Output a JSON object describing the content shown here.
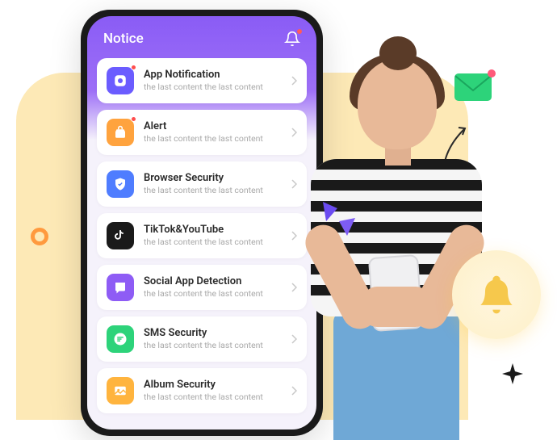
{
  "header": {
    "title": "Notice"
  },
  "items": [
    {
      "title": "App Notification",
      "sub": "the last content the last content",
      "icon": "app-notification-icon",
      "bg": "ic-notif",
      "dot": true
    },
    {
      "title": "Alert",
      "sub": "the last content the last content",
      "icon": "alert-icon",
      "bg": "ic-alert",
      "dot": true
    },
    {
      "title": "Browser Security",
      "sub": "the last content the last content",
      "icon": "browser-security-icon",
      "bg": "ic-browser",
      "dot": false
    },
    {
      "title": "TikTok&YouTube",
      "sub": "the last content the last content",
      "icon": "tiktok-youtube-icon",
      "bg": "ic-tiktok",
      "dot": false
    },
    {
      "title": "Social App Detection",
      "sub": "the last content the last content",
      "icon": "social-app-icon",
      "bg": "ic-social",
      "dot": false
    },
    {
      "title": "SMS Security",
      "sub": "the last content the last content",
      "icon": "sms-security-icon",
      "bg": "ic-sms",
      "dot": false
    },
    {
      "title": "Album Security",
      "sub": "the last content the last content",
      "icon": "album-security-icon",
      "bg": "ic-album",
      "dot": false
    }
  ],
  "colors": {
    "accent": "#8a5cf5",
    "bg_blob": "#fde9b6",
    "ring": "#ff9a3e",
    "bell": "#f6c84c",
    "mail": "#2dd37a"
  }
}
